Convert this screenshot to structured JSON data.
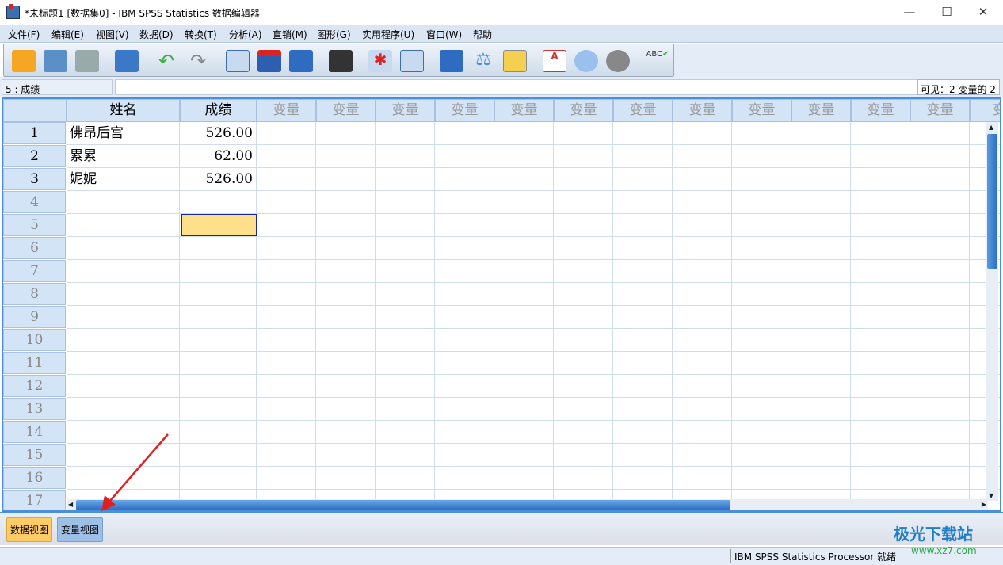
{
  "window": {
    "title": "*未标题1 [数据集0] - IBM SPSS Statistics 数据编辑器",
    "minimize": "—",
    "maximize": "☐",
    "close": "✕"
  },
  "menu": [
    "文件(F)",
    "编辑(E)",
    "视图(V)",
    "数据(D)",
    "转换(T)",
    "分析(A)",
    "直销(M)",
    "图形(G)",
    "实用程序(U)",
    "窗口(W)",
    "帮助"
  ],
  "toolbar": [
    "open-icon",
    "save-icon",
    "print-icon",
    "dialog-recall-icon",
    "undo-icon",
    "redo-icon",
    "goto-case-icon",
    "goto-variable-icon",
    "variables-icon",
    "find-icon",
    "insert-cases-icon",
    "insert-variable-icon",
    "split-file-icon",
    "weight-cases-icon",
    "select-cases-icon",
    "value-labels-icon",
    "use-sets-icon",
    "show-all-variables-icon",
    "spell-check-icon"
  ],
  "cellbar": {
    "ref": "5 : 成绩",
    "value": "",
    "visible": "可见：2 变量的 2"
  },
  "grid": {
    "columns": [
      "姓名",
      "成绩",
      "变量",
      "变量",
      "变量",
      "变量",
      "变量",
      "变量",
      "变量",
      "变量",
      "变量",
      "变量",
      "变量",
      "变量",
      "变"
    ],
    "rows": [
      [
        "佛昂后宫",
        "526.00"
      ],
      [
        "累累",
        "62.00"
      ],
      [
        "妮妮",
        "526.00"
      ]
    ],
    "row_numbers": [
      "1",
      "2",
      "3",
      "4",
      "5",
      "6",
      "7",
      "8",
      "9",
      "10",
      "11",
      "12",
      "13",
      "14",
      "15",
      "16",
      "17"
    ]
  },
  "tabs": {
    "data_view": "数据视图",
    "variable_view": "变量视图"
  },
  "status": "IBM SPSS Statistics Processor 就绪",
  "watermark": {
    "name": "极光下载站",
    "url": "www.xz7.com"
  }
}
